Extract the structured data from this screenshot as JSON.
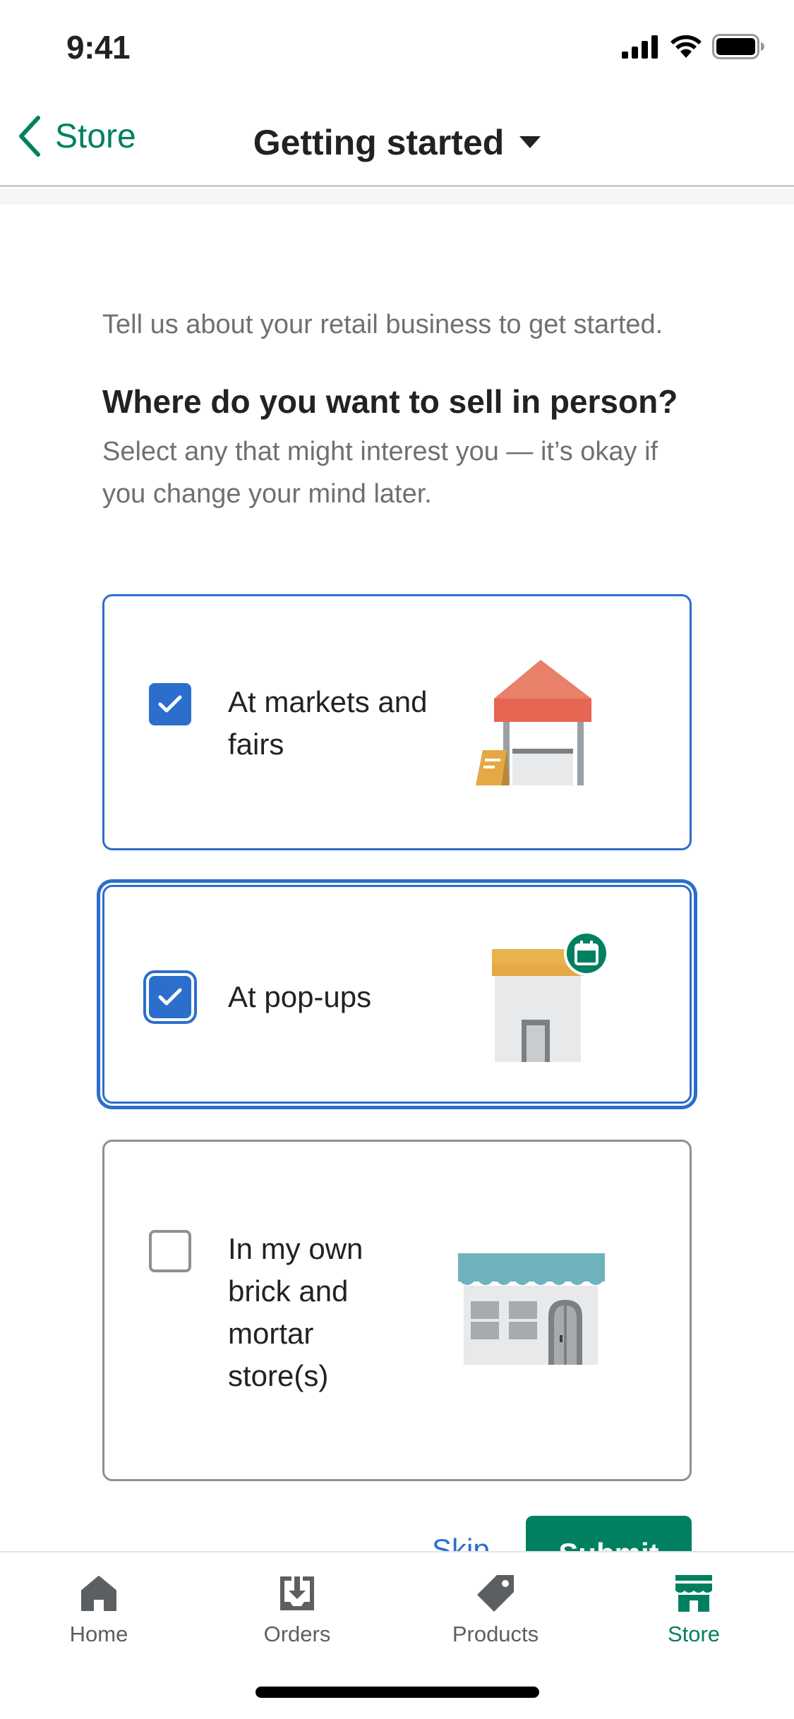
{
  "status_bar": {
    "time": "9:41"
  },
  "nav": {
    "back_label": "Store",
    "title": "Getting started"
  },
  "intro": "Tell us about your retail business to get started.",
  "question": "Where do you want to sell in person?",
  "hint": "Select any that might interest you — it’s okay if you change your mind later.",
  "options": [
    {
      "label": "At markets and fairs",
      "checked": true
    },
    {
      "label": "At pop-ups",
      "checked": true
    },
    {
      "label": "In my own brick and mortar store(s)",
      "checked": false
    }
  ],
  "actions": {
    "skip_label": "Skip",
    "submit_label": "Submit"
  },
  "tabs": [
    {
      "label": "Home",
      "icon": "home-icon",
      "active": false
    },
    {
      "label": "Orders",
      "icon": "orders-icon",
      "active": false
    },
    {
      "label": "Products",
      "icon": "tag-icon",
      "active": false
    },
    {
      "label": "Store",
      "icon": "store-icon",
      "active": true
    }
  ],
  "colors": {
    "accent_green": "#008060",
    "selected_blue": "#2c6ecb",
    "muted_text": "#6d7175"
  }
}
